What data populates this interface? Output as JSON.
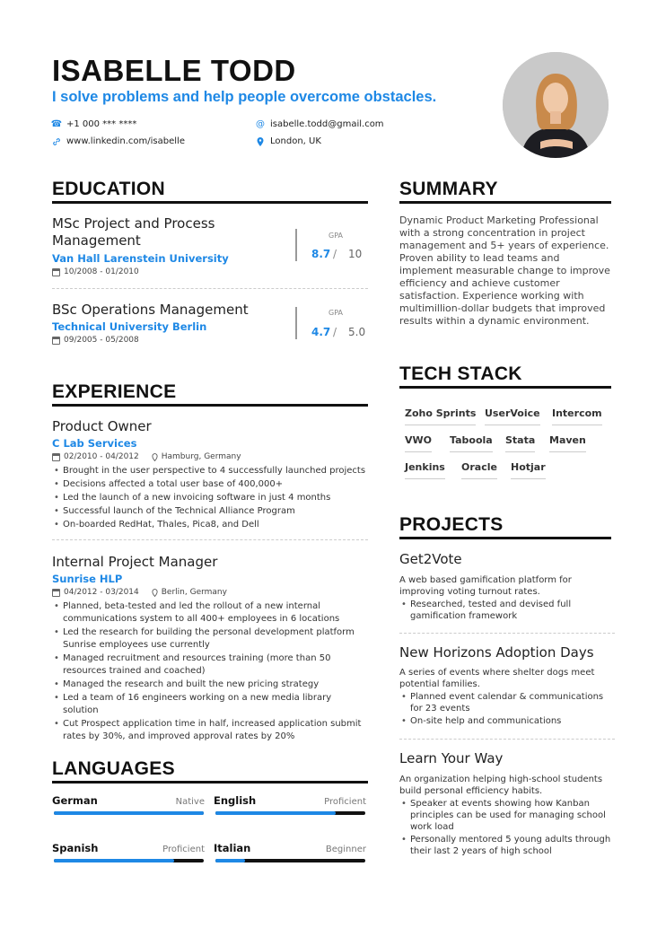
{
  "header": {
    "name": "ISABELLE TODD",
    "tagline": "I solve problems and help people overcome obstacles.",
    "phone": "+1 000 *** ****",
    "email": "isabelle.todd@gmail.com",
    "linkedin": "www.linkedin.com/isabelle",
    "location": "London, UK"
  },
  "education": {
    "title": "EDUCATION",
    "items": [
      {
        "degree": "MSc Project and Process Management",
        "school": "Van Hall Larenstein University",
        "dates": "10/2008 - 01/2010",
        "gpa_label": "GPA",
        "gpa": "8.7",
        "sep": "/",
        "gpa_max": "10"
      },
      {
        "degree": "BSc Operations Management",
        "school": "Technical University Berlin",
        "dates": "09/2005 - 05/2008",
        "gpa_label": "GPA",
        "gpa": "4.7",
        "sep": "/",
        "gpa_max": "5.0"
      }
    ]
  },
  "experience": {
    "title": "EXPERIENCE",
    "items": [
      {
        "role": "Product Owner",
        "company": "C Lab Services",
        "dates": "02/2010 - 04/2012",
        "location": "Hamburg, Germany",
        "bullets": [
          "Brought in the user perspective to 4 successfully launched projects",
          "Decisions affected a total user base of 400,000+",
          "Led the launch of a new invoicing software in just 4 months",
          "Successful launch of the Technical Alliance Program",
          "On-boarded RedHat, Thales, Pica8, and Dell"
        ]
      },
      {
        "role": "Internal Project Manager",
        "company": "Sunrise HLP",
        "dates": "04/2012 - 03/2014",
        "location": "Berlin, Germany",
        "bullets": [
          "Planned, beta-tested and led the rollout of a new internal communications system to all 400+ employees in 6 locations",
          "Led the research for building the personal development platform Sunrise employees use currently",
          "Managed recruitment and resources training (more than 50 resources trained and coached)",
          "Managed the research and built the new pricing strategy",
          "Led a team of 16 engineers working on a new media library solution",
          "Cut Prospect application time in half, increased application submit rates by 30%, and improved approval rates by 20%"
        ]
      }
    ]
  },
  "languages": {
    "title": "LANGUAGES",
    "items": [
      {
        "name": "German",
        "level": "Native",
        "fill": 1.0
      },
      {
        "name": "English",
        "level": "Proficient",
        "fill": 0.8
      },
      {
        "name": "Spanish",
        "level": "Proficient",
        "fill": 0.8
      },
      {
        "name": "Italian",
        "level": "Beginner",
        "fill": 0.2
      }
    ]
  },
  "summary": {
    "title": "SUMMARY",
    "text": "Dynamic Product Marketing Professional with a strong concentration in project management and 5+ years of experience. Proven ability to lead teams and implement measurable change to improve efficiency and achieve customer satisfaction. Experience working with multimillion-dollar budgets that improved results within a dynamic environment."
  },
  "tech": {
    "title": "TECH STACK",
    "tags": [
      "Zoho Sprints",
      "UserVoice",
      "Intercom",
      "VWO",
      "Taboola",
      "Stata",
      "Maven",
      "Jenkins",
      "Oracle",
      "Hotjar"
    ]
  },
  "projects": {
    "title": "PROJECTS",
    "items": [
      {
        "name": "Get2Vote",
        "desc": "A web based gamification platform for improving voting turnout rates.",
        "bullets": [
          "Researched, tested and devised full gamification framework"
        ]
      },
      {
        "name": "New Horizons Adoption Days",
        "desc": "A series of events where shelter dogs meet potential families.",
        "bullets": [
          "Planned event calendar & communications for 23 events",
          "On-site help and communications"
        ]
      },
      {
        "name": "Learn Your Way",
        "desc": "An organization helping high-school students build personal efficiency habits.",
        "bullets": [
          "Speaker at events showing how Kanban principles can be used for managing school work load",
          "Personally mentored 5 young adults through their last 2 years of high school"
        ]
      }
    ]
  }
}
